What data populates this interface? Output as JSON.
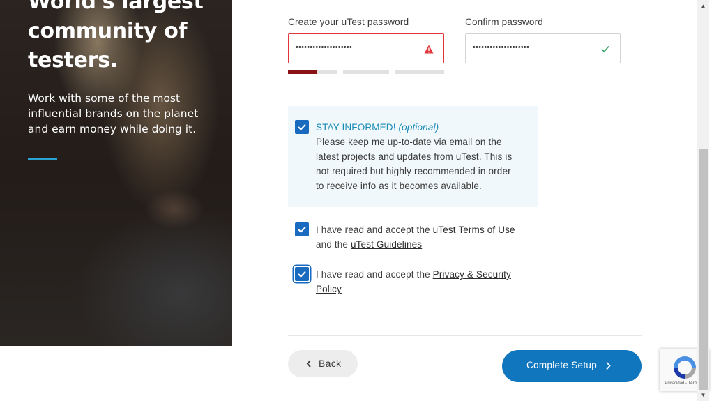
{
  "hero": {
    "title": "World's largest community of testers.",
    "subtitle": "Work with some of the most influential brands on the planet and earn money while doing it."
  },
  "password": {
    "label": "Create your uTest password",
    "value_masked": "••••••••••••••••••••",
    "state": "error",
    "icon": "warning-icon",
    "strength_level": 0.2
  },
  "confirm_password": {
    "label": "Confirm password",
    "value_masked": "••••••••••••••••••••",
    "state": "valid",
    "icon": "check-icon"
  },
  "stay_informed": {
    "checked": true,
    "heading": "STAY INFORMED!",
    "optional": "(optional)",
    "body": "Please keep me up-to-date via email on the latest projects and updates from uTest. This is not required but highly recommended in order to receive info as it becomes available."
  },
  "terms": {
    "checked": true,
    "prefix": "I have read and accept the",
    "link1": "uTest Terms of Use",
    "middle": "and the",
    "link2": "uTest Guidelines"
  },
  "privacy": {
    "checked": true,
    "prefix": "I have read and accept the",
    "link": "Privacy & Security Policy"
  },
  "buttons": {
    "back": "Back",
    "complete": "Complete Setup"
  },
  "recaptcha": {
    "text": "Privacidad - Términos"
  },
  "colors": {
    "primary": "#1076bd",
    "accent": "#1a8ab5",
    "error": "#e0363c",
    "success": "#2e9e5b",
    "strength": "#8a1115"
  }
}
